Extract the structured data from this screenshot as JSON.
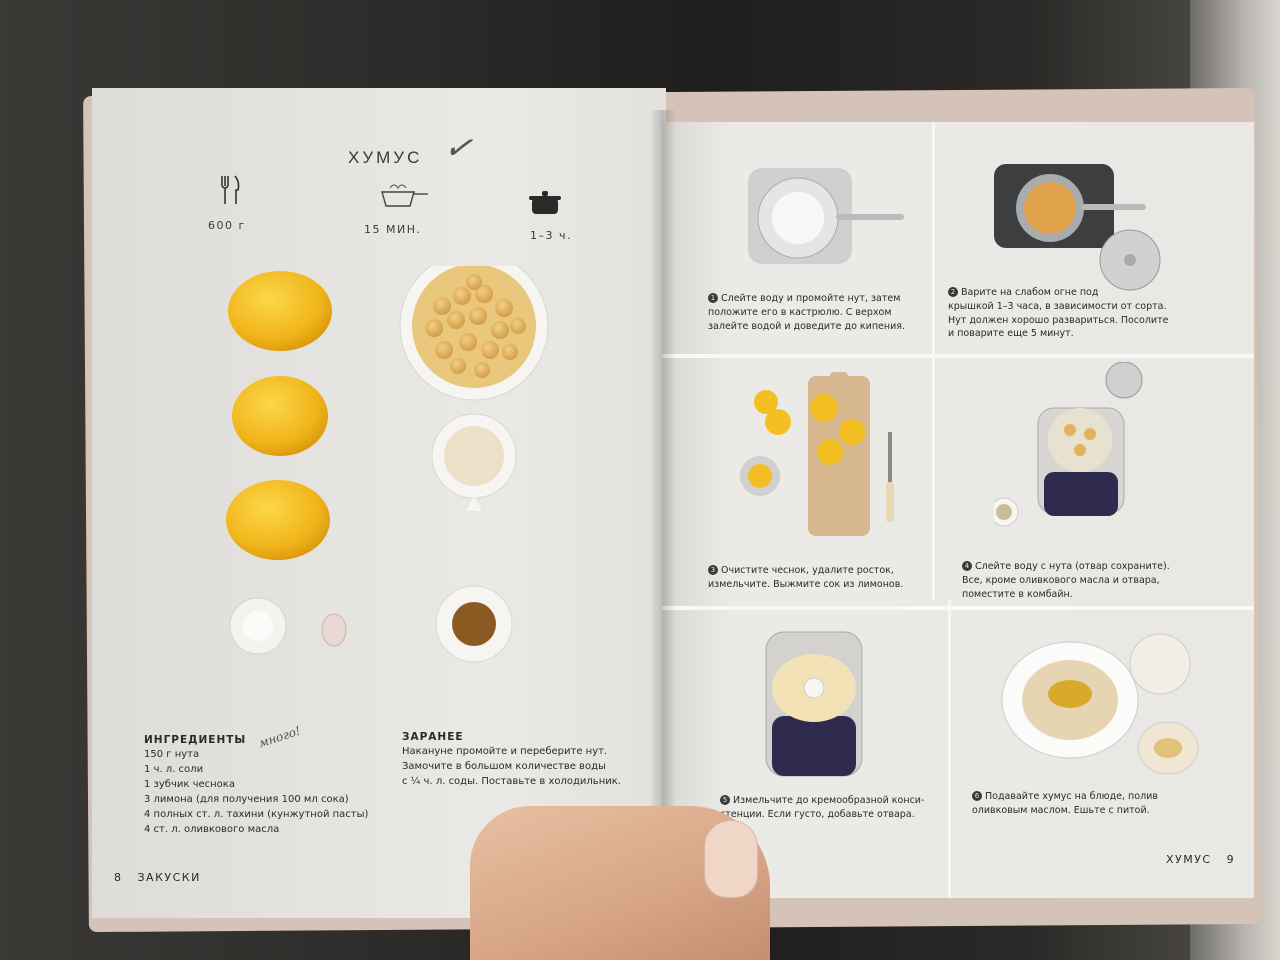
{
  "left_page": {
    "title": "ХУМУС",
    "check_mark": "✓",
    "icons": [
      {
        "icon": "fork-knife-icon",
        "label": "600 г"
      },
      {
        "icon": "pot-steam-icon",
        "label": "15 МИН."
      },
      {
        "icon": "cooking-pot-icon",
        "label": "1–3 ч."
      }
    ],
    "ingredients": {
      "heading": "ИНГРЕДИЕНТЫ",
      "items": [
        "150 г нута",
        "1 ч. л. соли",
        "1 зубчик чеснока",
        "3 лимона (для получения 100 мл сока)",
        "4 полных ст. л. тахини (кунжутной пасты)",
        "4 ст. л. оливкового масла"
      ],
      "handwritten_note": "много!"
    },
    "in_advance": {
      "heading": "ЗАРАНЕЕ",
      "lines": [
        "Накануне промойте и переберите нут.",
        "Замочите в большом количестве воды",
        "с ¼ ч. л. соды. Поставьте в холодильник."
      ]
    },
    "footer": {
      "page_number": "8",
      "section": "ЗАКУСКИ"
    }
  },
  "right_page": {
    "steps": [
      {
        "number": "1",
        "lines": [
          "Слейте воду и промойте нут, затем",
          "положите его в кастрюлю. С верхом",
          "залейте водой и доведите до кипения."
        ]
      },
      {
        "number": "2",
        "lines": [
          "Варите на слабом огне под",
          "крышкой 1–3 часа, в зависимости от сорта.",
          "Нут должен хорошо развариться. Посолите",
          "и поварите еще 5 минут."
        ]
      },
      {
        "number": "3",
        "lines": [
          "Очистите чеснок, удалите росток,",
          "измельчите. Выжмите сок из лимонов."
        ]
      },
      {
        "number": "4",
        "lines": [
          "Слейте воду с нута (отвар сохраните).",
          "Все, кроме оливкового масла и отвара,",
          "поместите в комбайн."
        ]
      },
      {
        "number": "5",
        "lines": [
          "Измельчите до кремообразной конси-",
          "стенции. Если густо, добавьте отвара."
        ]
      },
      {
        "number": "6",
        "lines": [
          "Подавайте хумус на блюде, полив",
          "оливковым маслом. Ешьте с питой."
        ]
      }
    ],
    "footer": {
      "section": "ХУМУС",
      "page_number": "9"
    }
  },
  "colors": {
    "page": "#e9e8e5",
    "text": "#2b2a28",
    "lemon": "#f2b81f",
    "chickpea": "#e3b25c"
  }
}
